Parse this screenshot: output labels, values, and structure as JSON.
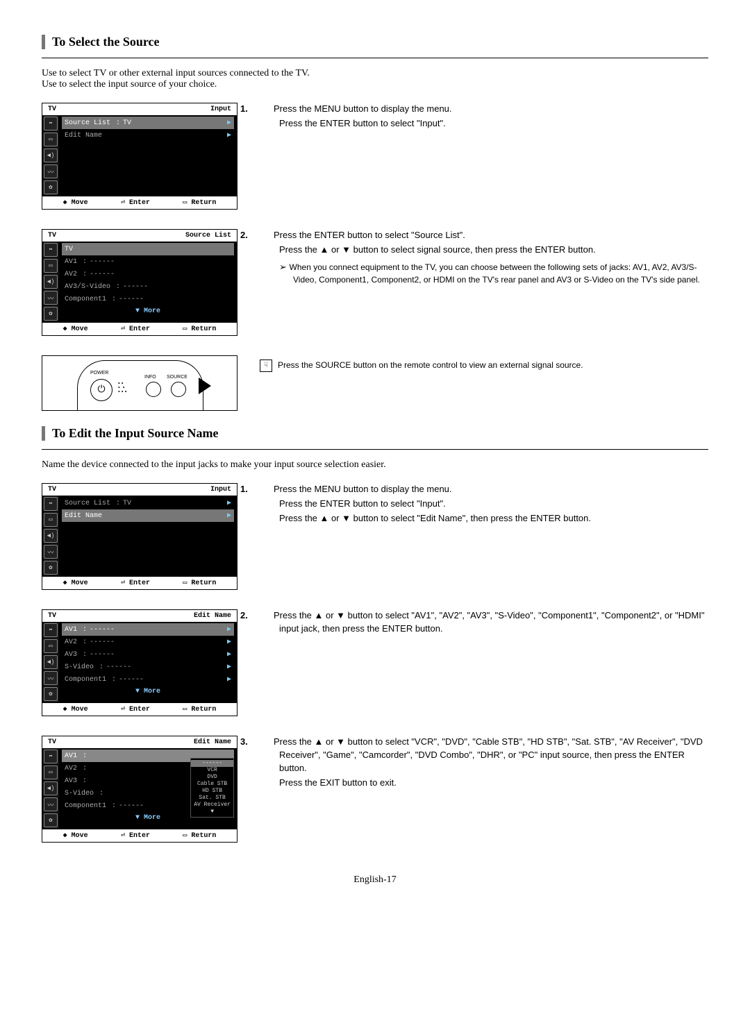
{
  "section1": {
    "title": "To Select the Source",
    "intro1": "Use to select TV or other external input sources connected to the TV.",
    "intro2": "Use to select the input source of your choice.",
    "step1_a": "Press the MENU button to display the menu.",
    "step1_b": "Press the ENTER button to select \"Input\".",
    "step2_a": "Press the ENTER button to select \"Source List\".",
    "step2_b": "Press the ▲ or ▼ button to select signal source, then press the ENTER button.",
    "step2_note": "When you connect equipment to the TV, you can choose between the following sets of jacks: AV1, AV2, AV3/S-Video, Component1, Component2, or HDMI on the TV's rear panel and AV3 or S-Video on the TV's side panel.",
    "source_tip": "Press the SOURCE button on the remote control to view an external signal source."
  },
  "section2": {
    "title": "To Edit the Input Source Name",
    "intro": "Name the device connected to the input jacks to make your input source selection easier.",
    "step1_a": "Press the MENU button to display the menu.",
    "step1_b": "Press the ENTER button to select \"Input\".",
    "step1_c": "Press the ▲ or ▼ button to select \"Edit Name\", then press the ENTER button.",
    "step2": "Press the ▲ or ▼ button to select \"AV1\", \"AV2\", \"AV3\", \"S-Video\", \"Component1\", \"Component2\", or \"HDMI\" input jack, then press the ENTER button.",
    "step3_a": "Press the ▲ or ▼ button to select \"VCR\", \"DVD\", \"Cable STB\", \"HD STB\", \"Sat. STB\", \"AV Receiver\", \"DVD Receiver\", \"Game\", \"Camcorder\", \"DVD Combo\", \"DHR\", or \"PC\" input source, then press the ENTER button.",
    "step3_b": "Press the EXIT button to exit."
  },
  "osd": {
    "tv": "TV",
    "input": "Input",
    "source_list_label": "Source List",
    "source_list_value": "TV",
    "edit_name": "Edit Name",
    "dashes": "------",
    "items_source": [
      "TV",
      "AV1",
      "AV2",
      "AV3/S-Video",
      "Component1"
    ],
    "items_edit": [
      "AV1",
      "AV2",
      "AV3",
      "S-Video",
      "Component1"
    ],
    "more": "▼ More",
    "move": "Move",
    "enter": "Enter",
    "return": "Return",
    "popup": [
      "------",
      "VCR",
      "DVD",
      "Cable STB",
      "HD STB",
      "Sat. STB",
      "AV Receiver",
      "▼"
    ]
  },
  "remote": {
    "power": "POWER",
    "info": "INFO",
    "source": "SOURCE"
  },
  "page": "English-17"
}
